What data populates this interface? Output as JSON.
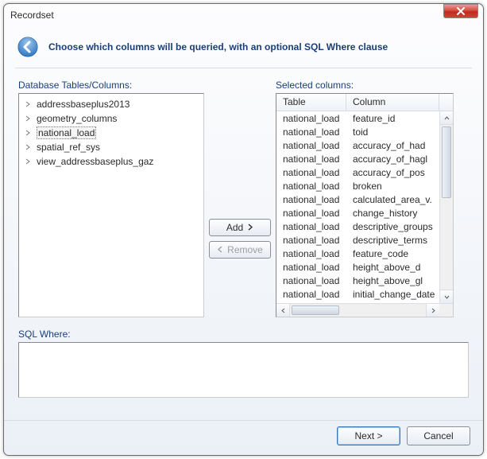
{
  "window": {
    "title": "Recordset"
  },
  "header": {
    "instruction": "Choose which columns will be queried, with an optional SQL Where clause"
  },
  "left": {
    "label": "Database Tables/Columns:",
    "items": [
      {
        "name": "addressbaseplus2013",
        "selected": false
      },
      {
        "name": "geometry_columns",
        "selected": false
      },
      {
        "name": "national_load",
        "selected": true
      },
      {
        "name": "spatial_ref_sys",
        "selected": false
      },
      {
        "name": "view_addressbaseplus_gaz",
        "selected": false
      }
    ]
  },
  "buttons": {
    "add": "Add",
    "remove": "Remove"
  },
  "right": {
    "label": "Selected columns:",
    "headers": {
      "table": "Table",
      "column": "Column"
    },
    "rows": [
      {
        "table": "national_load",
        "column": "feature_id"
      },
      {
        "table": "national_load",
        "column": "toid"
      },
      {
        "table": "national_load",
        "column": "accuracy_of_had"
      },
      {
        "table": "national_load",
        "column": "accuracy_of_hagl"
      },
      {
        "table": "national_load",
        "column": "accuracy_of_pos"
      },
      {
        "table": "national_load",
        "column": "broken"
      },
      {
        "table": "national_load",
        "column": "calculated_area_v."
      },
      {
        "table": "national_load",
        "column": "change_history"
      },
      {
        "table": "national_load",
        "column": "descriptive_groups"
      },
      {
        "table": "national_load",
        "column": "descriptive_terms"
      },
      {
        "table": "national_load",
        "column": "feature_code"
      },
      {
        "table": "national_load",
        "column": "height_above_d"
      },
      {
        "table": "national_load",
        "column": "height_above_gl"
      },
      {
        "table": "national_load",
        "column": "initial_change_date"
      }
    ]
  },
  "sql": {
    "label": "SQL Where:",
    "value": ""
  },
  "footer": {
    "next": "Next >",
    "cancel": "Cancel"
  }
}
